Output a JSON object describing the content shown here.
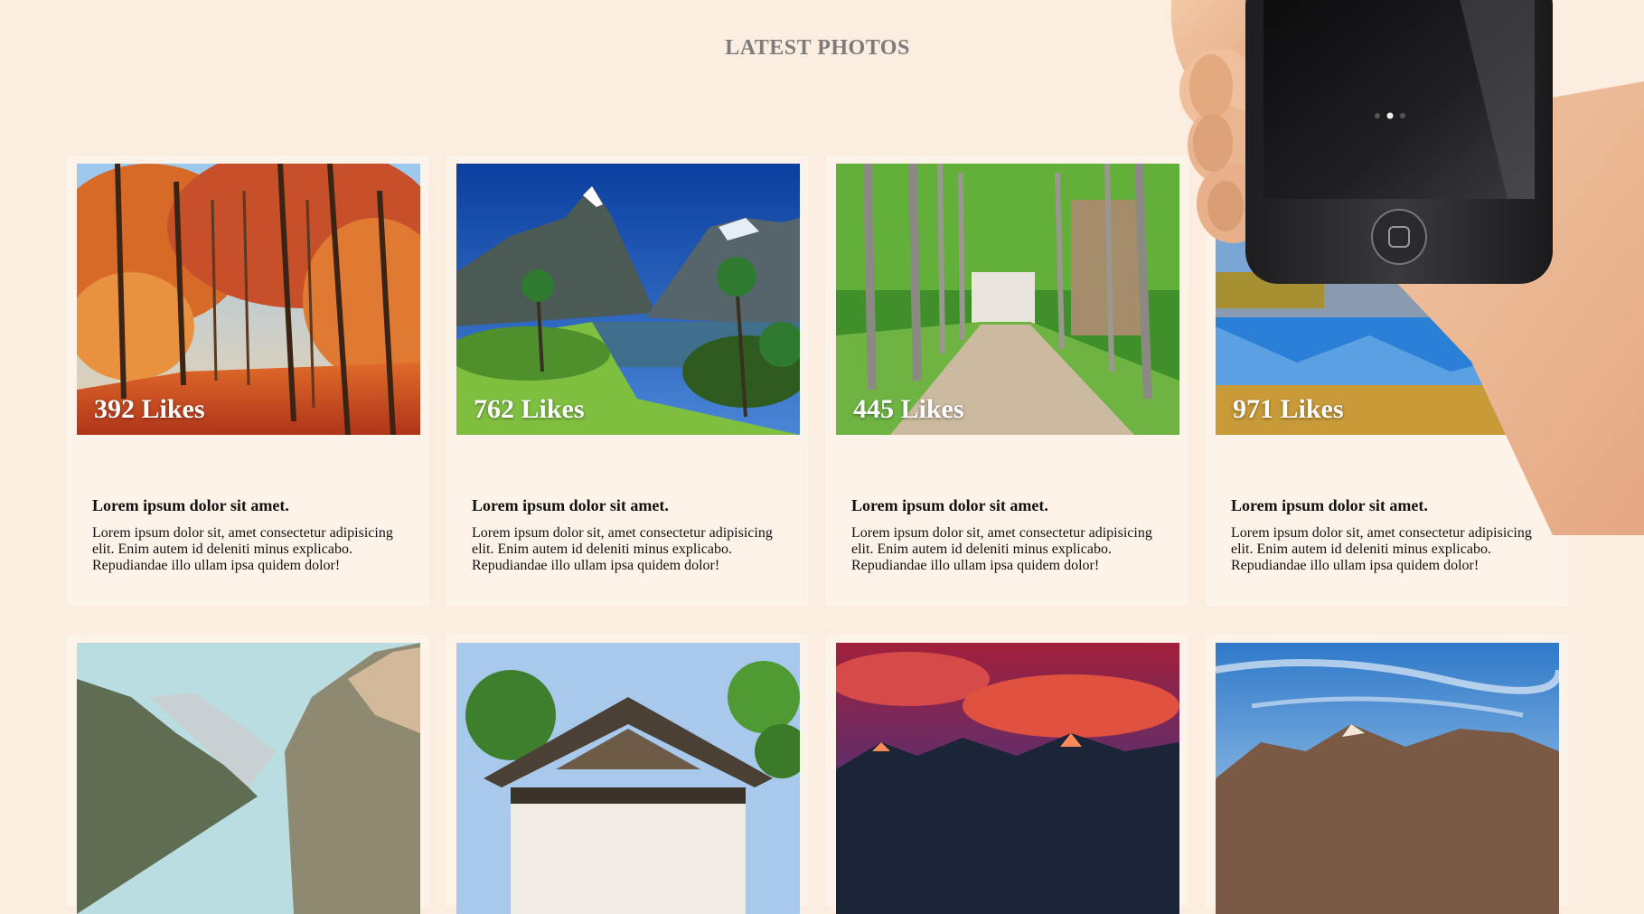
{
  "section": {
    "title": "LATEST PHOTOS"
  },
  "cards": [
    {
      "likes": "392 Likes",
      "title": "Lorem ipsum dolor sit amet.",
      "text": "Lorem ipsum dolor sit, amet consectetur adipisicing elit. Enim autem id deleniti minus explicabo. Repudiandae illo ullam ipsa quidem dolor!"
    },
    {
      "likes": "762 Likes",
      "title": "Lorem ipsum dolor sit amet.",
      "text": "Lorem ipsum dolor sit, amet consectetur adipisicing elit. Enim autem id deleniti minus explicabo. Repudiandae illo ullam ipsa quidem dolor!"
    },
    {
      "likes": "445 Likes",
      "title": "Lorem ipsum dolor sit amet.",
      "text": "Lorem ipsum dolor sit, amet consectetur adipisicing elit. Enim autem id deleniti minus explicabo. Repudiandae illo ullam ipsa quidem dolor!"
    },
    {
      "likes": "971 Likes",
      "title": "Lorem ipsum dolor sit amet.",
      "text": "Lorem ipsum dolor sit, amet consectetur adipisicing elit. Enim autem id deleniti minus explicabo. Repudiandae illo ullam ipsa quidem dolor!"
    }
  ]
}
